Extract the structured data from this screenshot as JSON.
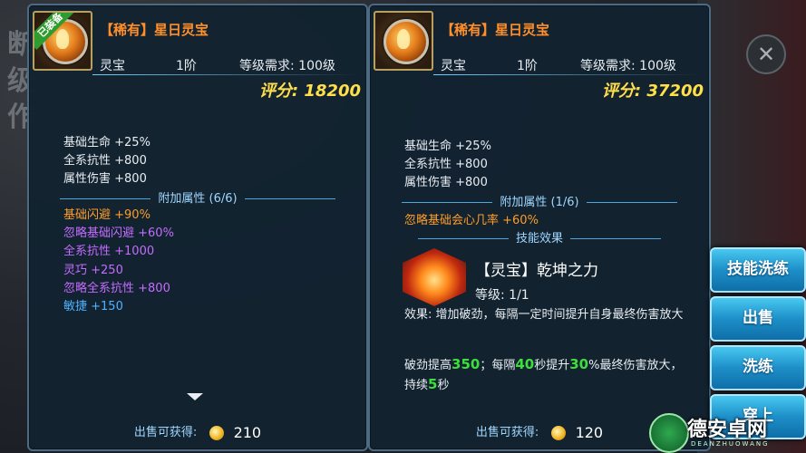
{
  "left_item": {
    "equipped_badge": "已装备",
    "title": "【稀有】星日灵宝",
    "type": "灵宝",
    "tier": "1阶",
    "level_req": "等级需求: 100级",
    "score": "评分: 18200",
    "base_stats": [
      "基础生命 +25%",
      "全系抗性 +800",
      "属性伤害 +800"
    ],
    "extra_header": "附加属性 (6/6)",
    "extra_stats": [
      {
        "text": "基础闪避 +90%",
        "color": "#ff9d2a"
      },
      {
        "text": "忽略基础闪避 +60%",
        "color": "#c46cff"
      },
      {
        "text": "全系抗性 +1000",
        "color": "#c46cff"
      },
      {
        "text": "灵巧 +250",
        "color": "#c46cff"
      },
      {
        "text": "忽略全系抗性 +800",
        "color": "#c46cff"
      },
      {
        "text": "敏捷 +150",
        "color": "#4fb2ff"
      }
    ],
    "sell_label": "出售可获得:",
    "sell_amount": "210"
  },
  "right_item": {
    "title": "【稀有】星日灵宝",
    "type": "灵宝",
    "tier": "1阶",
    "level_req": "等级需求: 100级",
    "score": "评分: 37200",
    "base_stats": [
      "基础生命 +25%",
      "全系抗性 +800",
      "属性伤害 +800"
    ],
    "extra_header": "附加属性 (1/6)",
    "extra_stats": [
      {
        "text": "忽略基础会心几率 +60%",
        "color": "#ff9d2a"
      }
    ],
    "skill_header": "技能效果",
    "skill_name": "【灵宝】乾坤之力",
    "skill_level": "等级: 1/1",
    "effect_text": "效果: 增加破劲，每隔一定时间提升自身最终伤害放大",
    "detail": {
      "p1": "破劲提高",
      "v1": "350",
      "p2": "；每隔",
      "v2": "40",
      "p3": "秒提升",
      "v3": "30",
      "p4": "%最终伤害放大，持续",
      "v4": "5",
      "p5": "秒"
    },
    "sell_label": "出售可获得:",
    "sell_amount": "120"
  },
  "actions": [
    "技能洗练",
    "出售",
    "洗练",
    "穿上"
  ],
  "background": {
    "chars": "断级作"
  },
  "watermark": {
    "text": "德安卓网",
    "sub": "DEANZHUOWANG"
  }
}
